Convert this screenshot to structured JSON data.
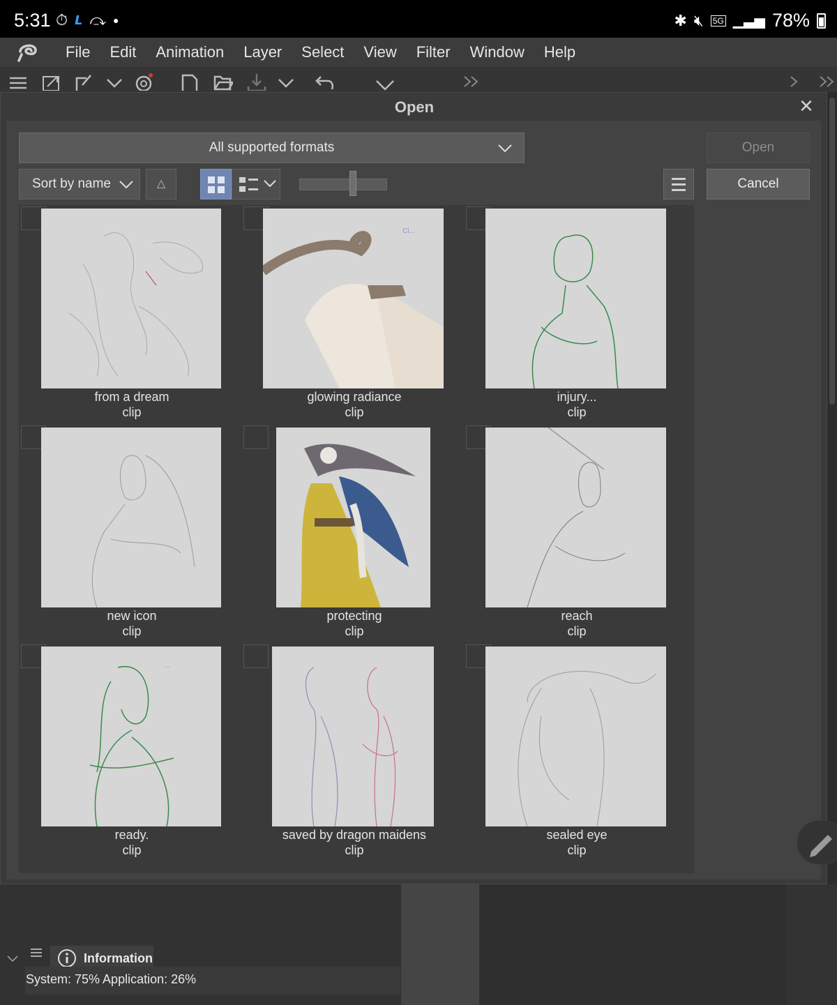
{
  "status_bar": {
    "time": "5:31",
    "battery": "78%",
    "network": "5G"
  },
  "menubar": {
    "items": [
      "File",
      "Edit",
      "Animation",
      "Layer",
      "Select",
      "View",
      "Filter",
      "Window",
      "Help"
    ]
  },
  "dialog": {
    "title": "Open",
    "format_filter": "All supported formats",
    "open_label": "Open",
    "cancel_label": "Cancel",
    "sort_label": "Sort by name",
    "sort_direction": "△",
    "thumbnail_size": 0.6,
    "files": [
      {
        "name": "from a dream",
        "ext": "clip"
      },
      {
        "name": "glowing radiance",
        "ext": "clip"
      },
      {
        "name": "injury...",
        "ext": "clip"
      },
      {
        "name": "new icon",
        "ext": "clip"
      },
      {
        "name": "protecting",
        "ext": "clip"
      },
      {
        "name": "reach",
        "ext": "clip"
      },
      {
        "name": "ready.",
        "ext": "clip"
      },
      {
        "name": "saved by dragon maidens",
        "ext": "clip"
      },
      {
        "name": "sealed eye",
        "ext": "clip"
      }
    ]
  },
  "info_panel": {
    "tab_label": "Information",
    "system_text": "System: 75%  Application: 26%"
  },
  "colors": {
    "accent_selected": "#6f86b3",
    "background": "#3a3a3a"
  }
}
